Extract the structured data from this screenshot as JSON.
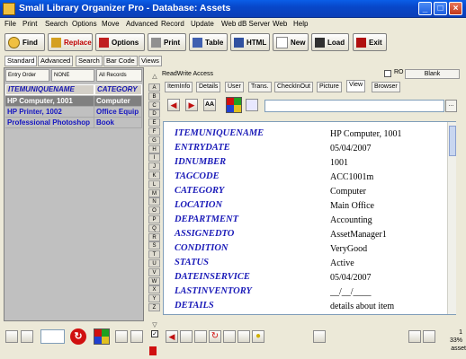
{
  "window": {
    "title": "Small Library Organizer Pro - Database: Assets"
  },
  "menu": [
    "File",
    "Print",
    "Search",
    "Options",
    "Move",
    "Advanced",
    "Record",
    "Update",
    "Web dB Server",
    "Web",
    "Help"
  ],
  "toolbar": {
    "find": "Find",
    "replace": "Replace",
    "options": "Options",
    "print": "Print",
    "table": "Table",
    "html": "HTML",
    "new": "New",
    "load": "Load",
    "exit": "Exit"
  },
  "search_tabs": [
    "Standard",
    "Advanced",
    "Search",
    "Bar Code",
    "Views"
  ],
  "sort_buttons": {
    "entry_order": "Entry Order",
    "none": "NONE",
    "all_records": "All Records"
  },
  "grid": {
    "columns": [
      "ITEMUNIQUENAME",
      "CATEGORY"
    ],
    "rows": [
      [
        "HP Computer, 1001",
        "Computer"
      ],
      [
        "HP Printer, 1002",
        "Office Equip"
      ],
      [
        "Professional Photoshop",
        "Book"
      ]
    ]
  },
  "alphabet": [
    "A",
    "B",
    "C",
    "D",
    "E",
    "F",
    "G",
    "H",
    "I",
    "J",
    "K",
    "L",
    "M",
    "N",
    "O",
    "P",
    "Q",
    "R",
    "S",
    "T",
    "U",
    "V",
    "W",
    "X",
    "Y",
    "Z"
  ],
  "access": {
    "label": "ReadWrite Access",
    "ro": "RO",
    "blank": "Blank"
  },
  "record_tabs": [
    "ItemInfo",
    "Details",
    "User",
    "Trans.",
    "CheckInOut",
    "Picture",
    "View",
    "Browser"
  ],
  "view_fields": [
    {
      "name": "ITEMUNIQUENAME",
      "value": "HP Computer, 1001"
    },
    {
      "name": "ENTRYDATE",
      "value": "05/04/2007"
    },
    {
      "name": "IDNUMBER",
      "value": "1001"
    },
    {
      "name": "TAGCODE",
      "value": "ACC1001m"
    },
    {
      "name": "CATEGORY",
      "value": "Computer"
    },
    {
      "name": "LOCATION",
      "value": "Main Office"
    },
    {
      "name": "DEPARTMENT",
      "value": "Accounting"
    },
    {
      "name": "ASSIGNEDTO",
      "value": "AssetManager1"
    },
    {
      "name": "CONDITION",
      "value": "VeryGood"
    },
    {
      "name": "STATUS",
      "value": "Active"
    },
    {
      "name": "DATEINSERVICE",
      "value": "05/04/2007"
    },
    {
      "name": "LASTINVENTORY",
      "value": "__/__/____"
    },
    {
      "name": "DETAILS",
      "value": "details about item"
    }
  ],
  "status": {
    "database": "asset",
    "record_no": "1",
    "zoom": "33%",
    "ellipsis": "..."
  },
  "colors": {
    "title_bar": "#0847c9",
    "field_name": "#1a1ab8",
    "selected_row": "#808080"
  }
}
